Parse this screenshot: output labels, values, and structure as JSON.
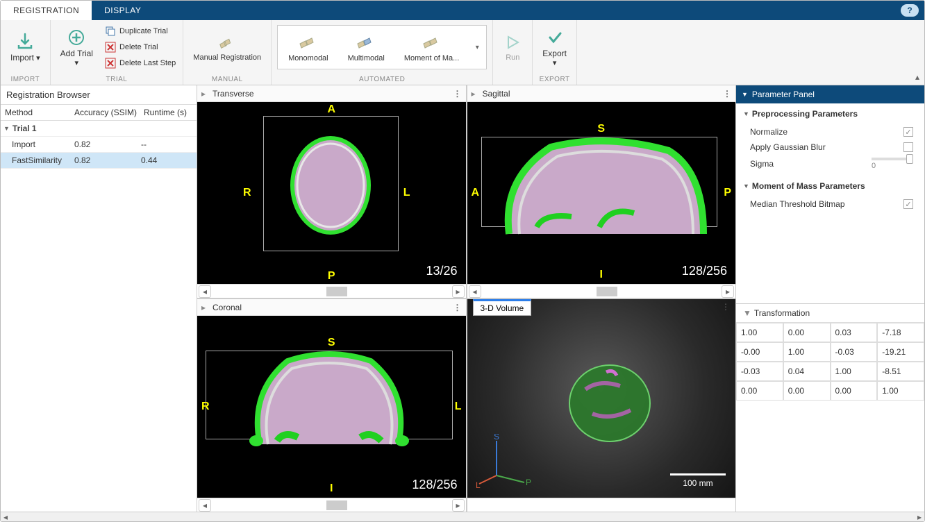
{
  "tabs": {
    "registration": "REGISTRATION",
    "display": "DISPLAY"
  },
  "ribbon": {
    "import": {
      "label": "Import",
      "group": "IMPORT"
    },
    "trial": {
      "addTrial": "Add Trial",
      "duplicate": "Duplicate Trial",
      "delete": "Delete Trial",
      "deleteLast": "Delete Last Step",
      "group": "TRIAL"
    },
    "manual": {
      "label": "Manual Registration",
      "group": "MANUAL"
    },
    "automated": {
      "monomodal": "Monomodal",
      "multimodal": "Multimodal",
      "moment": "Moment of Ma...",
      "group": "AUTOMATED"
    },
    "run": {
      "label": "Run"
    },
    "export": {
      "label": "Export",
      "group": "EXPORT"
    }
  },
  "regBrowser": {
    "title": "Registration Browser",
    "columns": {
      "method": "Method",
      "accuracy": "Accuracy (SSIM)",
      "runtime": "Runtime (s)"
    },
    "trial1Label": "Trial 1",
    "rows": [
      {
        "method": "Import",
        "accuracy": "0.82",
        "runtime": "--"
      },
      {
        "method": "FastSimilarity",
        "accuracy": "0.82",
        "runtime": "0.44"
      }
    ]
  },
  "views": {
    "transverse": {
      "label": "Transverse",
      "count": "13/26",
      "a": "A",
      "p": "P",
      "r": "R",
      "l": "L"
    },
    "sagittal": {
      "label": "Sagittal",
      "count": "128/256",
      "s": "S",
      "i": "I",
      "a": "A",
      "p": "P"
    },
    "coronal": {
      "label": "Coronal",
      "count": "128/256",
      "s": "S",
      "i": "I",
      "r": "R",
      "l": "L"
    },
    "volume3d": {
      "label": "3-D Volume",
      "scale": "100 mm",
      "s": "S",
      "l": "L",
      "p": "P"
    }
  },
  "paramPanel": {
    "title": "Parameter Panel",
    "preproc": {
      "title": "Preprocessing Parameters",
      "normalize": "Normalize",
      "blur": "Apply Gaussian Blur",
      "sigma": "Sigma",
      "sigmaVal": "0"
    },
    "moment": {
      "title": "Moment of Mass Parameters",
      "median": "Median Threshold Bitmap"
    }
  },
  "transform": {
    "title": "Transformation",
    "matrix": [
      [
        "1.00",
        "0.00",
        "0.03",
        "-7.18"
      ],
      [
        "-0.00",
        "1.00",
        "-0.03",
        "-19.21"
      ],
      [
        "-0.03",
        "0.04",
        "1.00",
        "-8.51"
      ],
      [
        "0.00",
        "0.00",
        "0.00",
        "1.00"
      ]
    ]
  }
}
